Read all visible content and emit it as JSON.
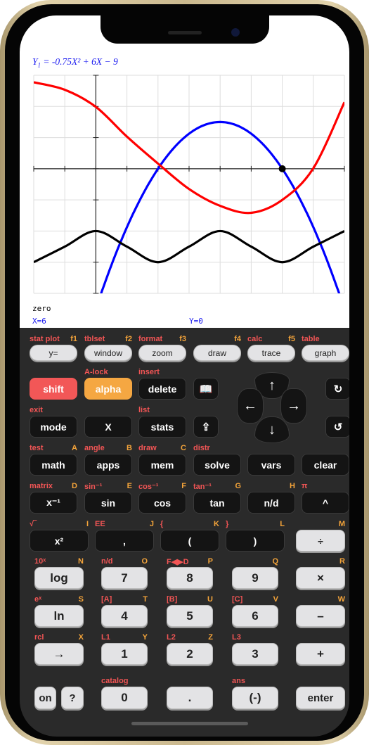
{
  "equation": {
    "lhs": "Y",
    "sub": "1",
    "rhs": " = -0.75X² + 6X − 9"
  },
  "status": {
    "mode": "zero",
    "x_readout": "X=6",
    "y_readout": "Y=0"
  },
  "chart_data": {
    "type": "line",
    "xlim": [
      -2,
      8
    ],
    "ylim": [
      -8,
      6
    ],
    "x_grid_step": 1,
    "y_grid_step": 2,
    "grid": true,
    "series": [
      {
        "formula": "-0.75X^2+6X-9",
        "color": "#0000ff",
        "x": [
          -2,
          -1,
          0,
          1,
          2,
          3,
          4,
          5,
          6,
          7,
          8
        ],
        "y": [
          -24,
          -15.75,
          -9,
          -3.75,
          0,
          2.25,
          3,
          2.25,
          0,
          -3.75,
          -9
        ]
      },
      {
        "color": "#ff0000",
        "x": [
          -2,
          -1,
          0,
          1,
          2,
          3,
          4,
          5,
          6,
          7,
          8
        ],
        "y": [
          5.55,
          5.07,
          3.97,
          2.06,
          0.33,
          -1.3,
          -2.38,
          -2.83,
          -2.0,
          0.03,
          4.27
        ]
      },
      {
        "color": "#000000",
        "x": [
          -2,
          -1,
          0,
          1,
          2,
          3,
          4,
          5,
          6,
          7,
          8
        ],
        "y": [
          -6,
          -5,
          -4,
          -5,
          -6,
          -5,
          -4,
          -5,
          -6,
          -5,
          -4
        ]
      }
    ],
    "highlight_point": {
      "x": 6,
      "y": 0
    }
  },
  "colors": {
    "shift": "#f25757",
    "alpha": "#f5a742",
    "shift_label": "#f25555",
    "alpha_label": "#f4a43a"
  },
  "keys": {
    "row1": [
      {
        "k": "y=",
        "s": "stat plot",
        "a": "f1"
      },
      {
        "k": "window",
        "s": "tblset",
        "a": "f2"
      },
      {
        "k": "zoom",
        "s": "format",
        "a": "f3"
      },
      {
        "k": "draw",
        "s": "",
        "a": "f4"
      },
      {
        "k": "trace",
        "s": "calc",
        "a": "f5"
      },
      {
        "k": "graph",
        "s": "table",
        "a": ""
      }
    ],
    "row2": [
      {
        "k": "shift",
        "s": "",
        "a": ""
      },
      {
        "k": "alpha",
        "s": "A-lock",
        "a": ""
      },
      {
        "k": "delete",
        "s": "insert",
        "a": ""
      }
    ],
    "row3": [
      {
        "k": "mode",
        "s": "exit",
        "a": ""
      },
      {
        "k": "X",
        "s": "",
        "a": ""
      },
      {
        "k": "stats",
        "s": "list",
        "a": ""
      }
    ],
    "icons": {
      "catalog": "book-icon",
      "share": "share-icon",
      "redo": "redo-icon",
      "undo": "undo-icon",
      "up": "arrow-up-icon",
      "down": "arrow-down-icon",
      "left": "arrow-left-icon",
      "right": "arrow-right-icon"
    },
    "row4": [
      {
        "k": "math",
        "s": "test",
        "a": "A"
      },
      {
        "k": "apps",
        "s": "angle",
        "a": "B"
      },
      {
        "k": "mem",
        "s": "draw",
        "a": "C"
      },
      {
        "k": "solve",
        "s": "distr",
        "a": ""
      },
      {
        "k": "vars",
        "s": "",
        "a": ""
      },
      {
        "k": "clear",
        "s": "",
        "a": ""
      }
    ],
    "row5": [
      {
        "k": "x⁻¹",
        "s": "matrix",
        "a": "D"
      },
      {
        "k": "sin",
        "s": "sin⁻¹",
        "a": "E"
      },
      {
        "k": "cos",
        "s": "cos⁻¹",
        "a": "F"
      },
      {
        "k": "tan",
        "s": "tan⁻¹",
        "a": "G"
      },
      {
        "k": "n/d",
        "s": "",
        "a": "H"
      },
      {
        "k": "^",
        "s": "π",
        "a": ""
      }
    ],
    "row6": [
      {
        "k": "x²",
        "s": "√‾",
        "a": "I"
      },
      {
        "k": ",",
        "s": "EE",
        "a": "J"
      },
      {
        "k": "(",
        "s": "{",
        "a": "K"
      },
      {
        "k": ")",
        "s": "}",
        "a": "L"
      },
      {
        "k": "÷",
        "s": "",
        "a": "M"
      }
    ],
    "row7": [
      {
        "k": "log",
        "s": "10ˣ",
        "a": "N"
      },
      {
        "k": "7",
        "s": "n/d",
        "a": "O"
      },
      {
        "k": "8",
        "s": "F◀▶D",
        "a": "P"
      },
      {
        "k": "9",
        "s": "",
        "a": "Q"
      },
      {
        "k": "×",
        "s": "",
        "a": "R"
      }
    ],
    "row8": [
      {
        "k": "ln",
        "s": "eˣ",
        "a": "S"
      },
      {
        "k": "4",
        "s": "[A]",
        "a": "T"
      },
      {
        "k": "5",
        "s": "[B]",
        "a": "U"
      },
      {
        "k": "6",
        "s": "[C]",
        "a": "V"
      },
      {
        "k": "–",
        "s": "",
        "a": "W"
      }
    ],
    "row9": [
      {
        "k": "→",
        "s": "rcl",
        "a": "X"
      },
      {
        "k": "1",
        "s": "L1",
        "a": "Y"
      },
      {
        "k": "2",
        "s": "L2",
        "a": "Z"
      },
      {
        "k": "3",
        "s": "L3",
        "a": ""
      },
      {
        "k": "+",
        "s": "",
        "a": ""
      }
    ],
    "row10": [
      {
        "k": "on",
        "s": "",
        "a": ""
      },
      {
        "k": "?",
        "s": "",
        "a": ""
      },
      {
        "k": "0",
        "s": "catalog",
        "a": ""
      },
      {
        "k": ".",
        "s": "",
        "a": ""
      },
      {
        "k": "(-)",
        "s": "ans",
        "a": ""
      },
      {
        "k": "enter",
        "s": "",
        "a": ""
      }
    ]
  }
}
